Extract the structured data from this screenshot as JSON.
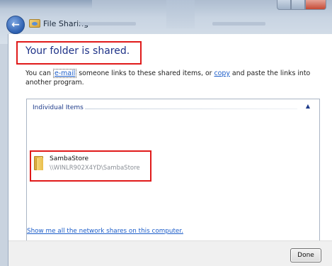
{
  "window": {
    "tab_title": "File Sharing",
    "back_glyph": "←"
  },
  "main": {
    "heading": "Your folder is shared.",
    "desc_prefix": "You can ",
    "email_link": "e-mail",
    "desc_middle": " someone links to these shared items, or ",
    "copy_link": "copy",
    "desc_suffix": " and paste the links into another program."
  },
  "panel": {
    "group_label": "Individual Items",
    "collapse_glyph": "▲",
    "items": [
      {
        "name": "SambaStore",
        "path": "\\\\WINLR902X4YD\\SambaStore",
        "icon": "folder-icon"
      }
    ]
  },
  "links": {
    "network_shares": "Show me all the network shares on this computer."
  },
  "footer": {
    "done_label": "Done"
  }
}
